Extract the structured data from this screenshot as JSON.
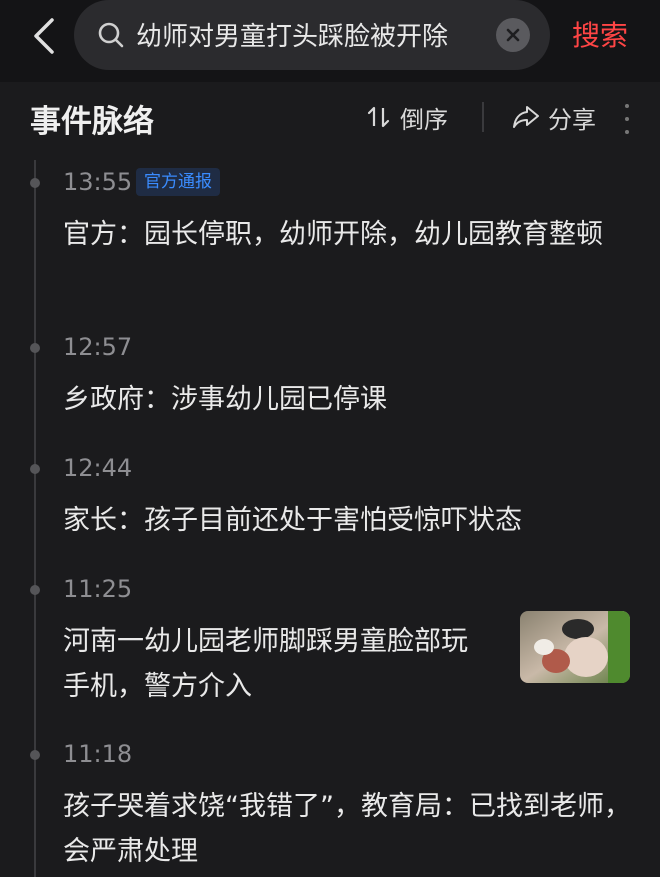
{
  "search": {
    "query": "幼师对男童打头踩脸被开除",
    "button_label": "搜索"
  },
  "header": {
    "title": "事件脉络",
    "sort_label": "倒序",
    "share_label": "分享"
  },
  "colors": {
    "accent_red": "#ff4545",
    "badge_blue": "#3a8cff",
    "background": "#1b1b1d"
  },
  "events": [
    {
      "time": "13:55",
      "badge": "官方通报",
      "title": "官方：园长停职，幼师开除，幼儿园教育整顿"
    },
    {
      "time": "12:57",
      "title": "乡政府：涉事幼儿园已停课"
    },
    {
      "time": "12:44",
      "title": "家长：孩子目前还处于害怕受惊吓状态"
    },
    {
      "time": "11:25",
      "title": "河南一幼儿园老师脚踩男童脸部玩手机，警方介入",
      "has_thumbnail": true
    },
    {
      "time": "11:18",
      "title": "孩子哭着求饶“我错了”，教育局：已找到老师，会严肃处理"
    }
  ]
}
